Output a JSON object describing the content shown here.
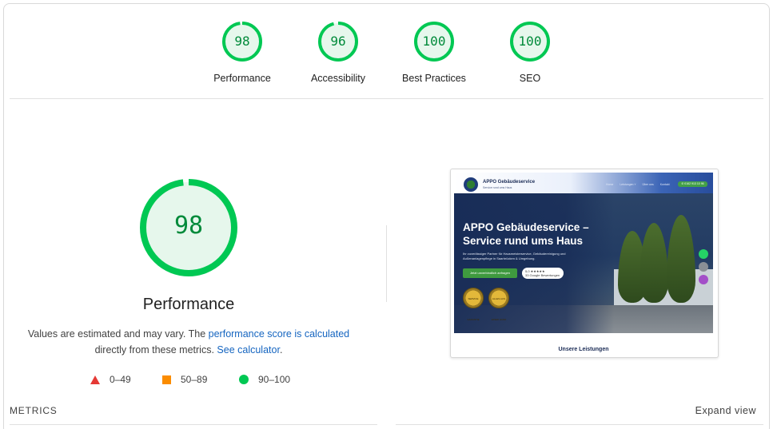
{
  "scores": [
    {
      "label": "Performance",
      "value": "98",
      "score": 98
    },
    {
      "label": "Accessibility",
      "value": "96",
      "score": 96
    },
    {
      "label": "Best Practices",
      "value": "100",
      "score": 100
    },
    {
      "label": "SEO",
      "value": "100",
      "score": 100
    }
  ],
  "main_gauge": {
    "value": "98",
    "score": 98,
    "title": "Performance"
  },
  "note": {
    "part1": "Values are estimated and may vary. The ",
    "link1": "performance score is calculated",
    "part2": "directly from these metrics. ",
    "link2": "See calculator",
    "part3": "."
  },
  "legend": [
    {
      "range": "0–49",
      "shape": "triangle",
      "color": "#e53935"
    },
    {
      "range": "50–89",
      "shape": "square",
      "color": "#fb8c00"
    },
    {
      "range": "90–100",
      "shape": "circle",
      "color": "#00c853"
    }
  ],
  "colors": {
    "pass": "#00c853",
    "pass_text": "#008a3a",
    "pass_fill": "#e6f7ec"
  },
  "preview": {
    "brand": "APPO Gebäudeservice",
    "tagline": "Service rund ums Haus",
    "nav": [
      "Home",
      "Leistungen ˅",
      "Über uns",
      "Kontakt"
    ],
    "cta": "✆ 0162 913 10 96",
    "hero_title": "APPO Gebäudeservice – Service rund ums Haus",
    "hero_text": "Ihr zuverlässiger Partner für Hausmeisterservice, Gebäudereinigung und Außenanlagenpflege in Saarbrücken & Umgebung.",
    "hero_button": "Jetzt unverbindlich anfragen",
    "rating": "5,0 ★★★★★",
    "rating_sub": "33 Google Bewertungen",
    "seal1": "SERVICE GARANTIE",
    "seal2": "ALLES AUS EINER HAND",
    "section_heading": "Unsere Leistungen"
  },
  "metrics_label": "METRICS",
  "expand_label": "Expand view"
}
